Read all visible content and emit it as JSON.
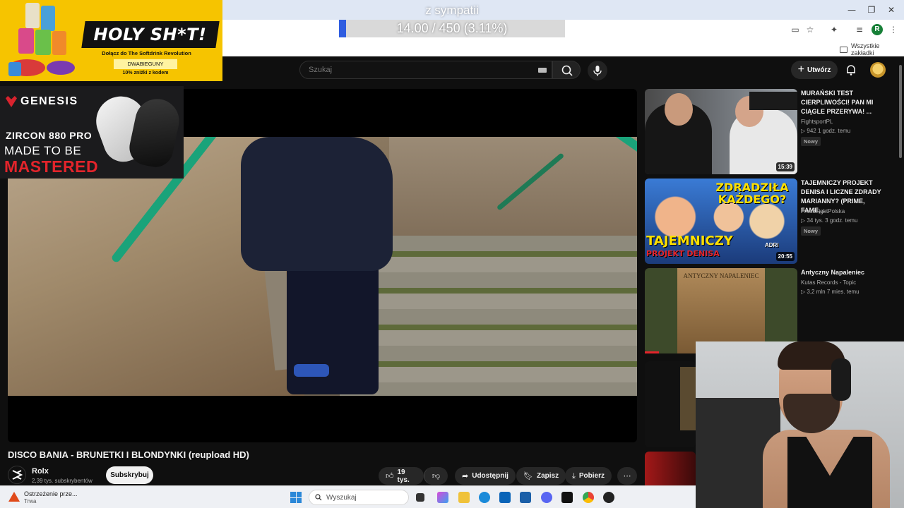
{
  "browser": {
    "bookmarks_all": "Wszystkie zakładki",
    "profile_initial": "R"
  },
  "donation_goal": {
    "title": "z sympatii",
    "progress_text": "14.00 / 450 (3.11%)",
    "progress_fraction": 0.0311,
    "accent": "#2f5de0"
  },
  "ad_holy": {
    "headline": "HOLY SH*T!",
    "sub": "Dołącz do The Softdrink Revolution",
    "code": "DWABIEGUNY",
    "discount": "10% zniżki z kodem",
    "bg": "#f6c400"
  },
  "ad_genesis": {
    "brand": "GENESIS",
    "model": "ZIRCON 880 PRO",
    "tag1": "MADE TO BE",
    "tag2": "MASTERED",
    "accent": "#e3242b"
  },
  "masthead": {
    "search_placeholder": "Szukaj",
    "create_label": "Utwórz"
  },
  "video": {
    "title": "DISCO BANIA - BRUNETKI I BLONDYNKI (reupload HD)",
    "channel": "Rolx",
    "subscribers": "2,39 tys. subskrybentów",
    "subscribe_label": "Subskrybuj",
    "likes": "19 tys.",
    "share_label": "Udostępnij",
    "save_label": "Zapisz",
    "download_label": "Pobierz"
  },
  "recommendations": [
    {
      "title": "MURAŃSKI TEST CIERPLIWOŚCI! PAN MI CIĄGLE PRZERYWA! ...",
      "channel": "FightsportPL",
      "stats": "▷ 942   1 godz. temu",
      "badge": "Nowy",
      "duration": "15:39"
    },
    {
      "title": "TAJEMNICZY PROJEKT DENISA I LICZNE ZDRADY MARIANNY? (PRIME, FAME,...",
      "channel": "FreakFightPolska",
      "stats": "▷ 34 tys.   3 godz. temu",
      "badge": "Nowy",
      "duration": "20:55",
      "thumb_text_top": "ZDRADZIŁA KAŻDEGO?",
      "thumb_text_bottom": "TAJEMNICZY",
      "thumb_text_bottom2": "PROJEKT DENISA",
      "thumb_name": "ADRI"
    },
    {
      "title": "Antyczny Napaleniec",
      "channel": "Kutas Records - Topic",
      "stats": "▷ 3,2 mln   7 mies. temu",
      "thumb_text": "ANTYCZNY NAPALENIEC"
    }
  ],
  "taskbar": {
    "warning_title": "Ostrzeżenie prze...",
    "warning_sub": "Trwa",
    "search_placeholder": "Wyszukaj"
  }
}
